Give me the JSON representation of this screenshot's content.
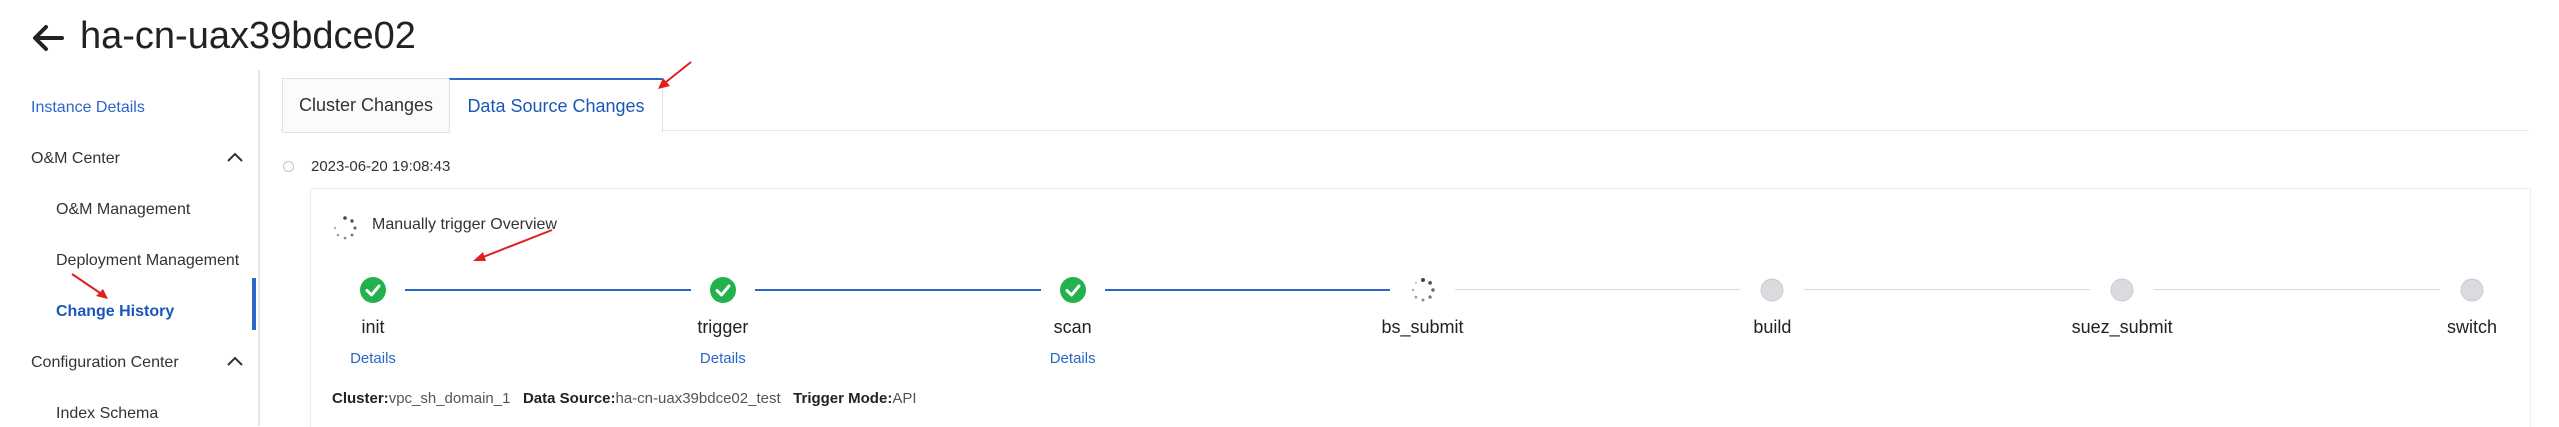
{
  "header": {
    "title": "ha-cn-uax39bdce02"
  },
  "sidebar": {
    "items": [
      {
        "label": "Instance Details",
        "type": "link"
      },
      {
        "label": "O&M Center",
        "type": "group"
      },
      {
        "label": "O&M Management",
        "type": "sub"
      },
      {
        "label": "Deployment Management",
        "type": "sub"
      },
      {
        "label": "Change History",
        "type": "sub-active"
      },
      {
        "label": "Configuration Center",
        "type": "group"
      },
      {
        "label": "Index Schema",
        "type": "sub"
      }
    ]
  },
  "tabs": [
    {
      "label": "Cluster Changes",
      "active": false
    },
    {
      "label": "Data Source Changes",
      "active": true
    }
  ],
  "timeline": {
    "timestamp": "2023-06-20 19:08:43",
    "overview_label": "Manually trigger Overview",
    "steps": [
      {
        "name": "init",
        "status": "done",
        "details": "Details"
      },
      {
        "name": "trigger",
        "status": "done",
        "details": "Details"
      },
      {
        "name": "scan",
        "status": "done",
        "details": "Details"
      },
      {
        "name": "bs_submit",
        "status": "running",
        "details": ""
      },
      {
        "name": "build",
        "status": "pending",
        "details": ""
      },
      {
        "name": "suez_submit",
        "status": "pending",
        "details": ""
      },
      {
        "name": "switch",
        "status": "pending",
        "details": ""
      }
    ],
    "info": {
      "cluster_label": "Cluster:",
      "cluster_value": "vpc_sh_domain_1",
      "source_label": "Data Source:",
      "source_value": "ha-cn-uax39bdce02_test",
      "mode_label": "Trigger Mode:",
      "mode_value": "API"
    }
  },
  "colors": {
    "accent": "#2a67c9",
    "success": "#22b14c",
    "pending": "#d9dbdf",
    "annotation_arrow": "#e02020"
  }
}
